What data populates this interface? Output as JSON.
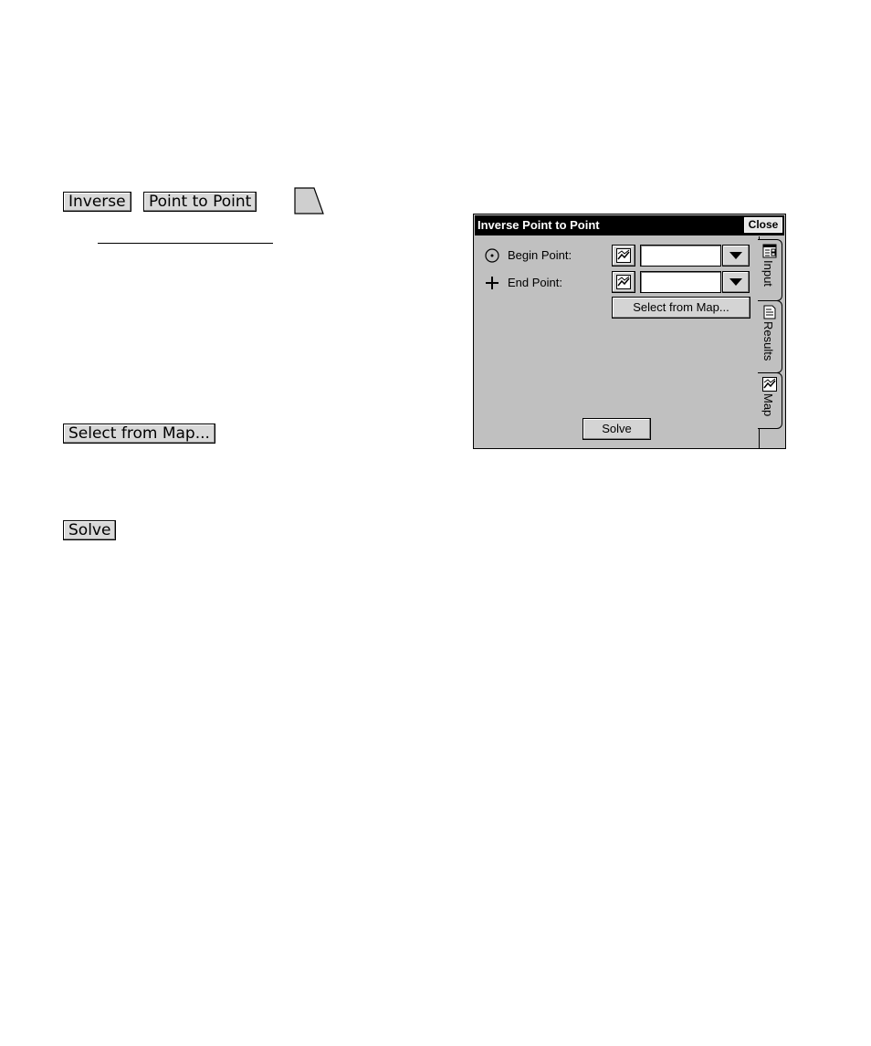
{
  "doc": {
    "inverse_button": "Inverse",
    "point_to_point_button": "Point to Point",
    "select_from_map_button": "Select from Map...",
    "solve_button": "Solve"
  },
  "window": {
    "title": "Inverse Point to Point",
    "close_label": "Close",
    "begin_point_label": "Begin Point:",
    "end_point_label": "End Point:",
    "begin_point_value": "",
    "end_point_value": "",
    "select_from_map_label": "Select from Map...",
    "solve_label": "Solve",
    "tabs": [
      {
        "label": "Input",
        "icon": "input-icon",
        "active": true
      },
      {
        "label": "Results",
        "icon": "results-icon",
        "active": false
      },
      {
        "label": "Map",
        "icon": "map-icon",
        "active": false
      }
    ]
  },
  "colors": {
    "window_bg": "#c0c0c0",
    "titlebar_bg": "#000000",
    "doc_button_bg": "#d9d9d9"
  }
}
